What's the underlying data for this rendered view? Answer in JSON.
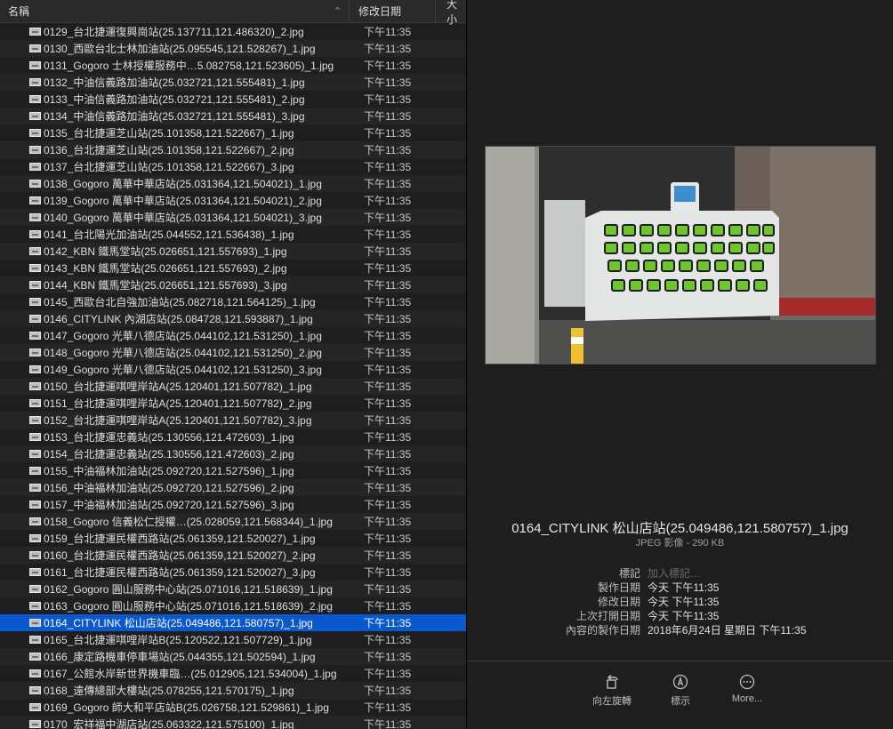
{
  "header": {
    "col_name": "名稱",
    "col_date": "修改日期",
    "col_size": "大小"
  },
  "files": [
    {
      "name": "0129_台北捷運復興崗站(25.137711,121.486320)_2.jpg",
      "date": "下午11:35"
    },
    {
      "name": "0130_西歐台北士林加油站(25.095545,121.528267)_1.jpg",
      "date": "下午11:35"
    },
    {
      "name": "0131_Gogoro 士林授權服務中…5.082758,121.523605)_1.jpg",
      "date": "下午11:35"
    },
    {
      "name": "0132_中油信義路加油站(25.032721,121.555481)_1.jpg",
      "date": "下午11:35"
    },
    {
      "name": "0133_中油信義路加油站(25.032721,121.555481)_2.jpg",
      "date": "下午11:35"
    },
    {
      "name": "0134_中油信義路加油站(25.032721,121.555481)_3.jpg",
      "date": "下午11:35"
    },
    {
      "name": "0135_台北捷運芝山站(25.101358,121.522667)_1.jpg",
      "date": "下午11:35"
    },
    {
      "name": "0136_台北捷運芝山站(25.101358,121.522667)_2.jpg",
      "date": "下午11:35"
    },
    {
      "name": "0137_台北捷運芝山站(25.101358,121.522667)_3.jpg",
      "date": "下午11:35"
    },
    {
      "name": "0138_Gogoro 萬華中華店站(25.031364,121.504021)_1.jpg",
      "date": "下午11:35"
    },
    {
      "name": "0139_Gogoro 萬華中華店站(25.031364,121.504021)_2.jpg",
      "date": "下午11:35"
    },
    {
      "name": "0140_Gogoro 萬華中華店站(25.031364,121.504021)_3.jpg",
      "date": "下午11:35"
    },
    {
      "name": "0141_台北陽光加油站(25.044552,121.536438)_1.jpg",
      "date": "下午11:35"
    },
    {
      "name": "0142_KBN 鐵馬堂站(25.026651,121.557693)_1.jpg",
      "date": "下午11:35"
    },
    {
      "name": "0143_KBN 鐵馬堂站(25.026651,121.557693)_2.jpg",
      "date": "下午11:35"
    },
    {
      "name": "0144_KBN 鐵馬堂站(25.026651,121.557693)_3.jpg",
      "date": "下午11:35"
    },
    {
      "name": "0145_西歐台北自強加油站(25.082718,121.564125)_1.jpg",
      "date": "下午11:35"
    },
    {
      "name": "0146_CITYLINK 內湖店站(25.084728,121.593887)_1.jpg",
      "date": "下午11:35"
    },
    {
      "name": "0147_Gogoro 光華八德店站(25.044102,121.531250)_1.jpg",
      "date": "下午11:35"
    },
    {
      "name": "0148_Gogoro 光華八德店站(25.044102,121.531250)_2.jpg",
      "date": "下午11:35"
    },
    {
      "name": "0149_Gogoro 光華八德店站(25.044102,121.531250)_3.jpg",
      "date": "下午11:35"
    },
    {
      "name": "0150_台北捷運唭哩岸站A(25.120401,121.507782)_1.jpg",
      "date": "下午11:35"
    },
    {
      "name": "0151_台北捷運唭哩岸站A(25.120401,121.507782)_2.jpg",
      "date": "下午11:35"
    },
    {
      "name": "0152_台北捷運唭哩岸站A(25.120401,121.507782)_3.jpg",
      "date": "下午11:35"
    },
    {
      "name": "0153_台北捷運忠義站(25.130556,121.472603)_1.jpg",
      "date": "下午11:35"
    },
    {
      "name": "0154_台北捷運忠義站(25.130556,121.472603)_2.jpg",
      "date": "下午11:35"
    },
    {
      "name": "0155_中油福林加油站(25.092720,121.527596)_1.jpg",
      "date": "下午11:35"
    },
    {
      "name": "0156_中油福林加油站(25.092720,121.527596)_2.jpg",
      "date": "下午11:35"
    },
    {
      "name": "0157_中油福林加油站(25.092720,121.527596)_3.jpg",
      "date": "下午11:35"
    },
    {
      "name": "0158_Gogoro 信義松仁授權…(25.028059,121.568344)_1.jpg",
      "date": "下午11:35"
    },
    {
      "name": "0159_台北捷運民權西路站(25.061359,121.520027)_1.jpg",
      "date": "下午11:35"
    },
    {
      "name": "0160_台北捷運民權西路站(25.061359,121.520027)_2.jpg",
      "date": "下午11:35"
    },
    {
      "name": "0161_台北捷運民權西路站(25.061359,121.520027)_3.jpg",
      "date": "下午11:35"
    },
    {
      "name": "0162_Gogoro 圓山服務中心站(25.071016,121.518639)_1.jpg",
      "date": "下午11:35"
    },
    {
      "name": "0163_Gogoro 圓山服務中心站(25.071016,121.518639)_2.jpg",
      "date": "下午11:35"
    },
    {
      "name": "0164_CITYLINK 松山店站(25.049486,121.580757)_1.jpg",
      "date": "下午11:35"
    },
    {
      "name": "0165_台北捷運唭哩岸站B(25.120522,121.507729)_1.jpg",
      "date": "下午11:35"
    },
    {
      "name": "0166_康定路機車停車場站(25.044355,121.502594)_1.jpg",
      "date": "下午11:35"
    },
    {
      "name": "0167_公館水岸新世界機車臨…(25.012905,121.534004)_1.jpg",
      "date": "下午11:35"
    },
    {
      "name": "0168_遠傳總部大樓站(25.078255,121.570175)_1.jpg",
      "date": "下午11:35"
    },
    {
      "name": "0169_Gogoro 師大和平店站B(25.026758,121.529861)_1.jpg",
      "date": "下午11:35"
    },
    {
      "name": "0170_宏祥福中湖店站(25.063322,121.575100)_1.jpg",
      "date": "下午11:35"
    }
  ],
  "selected_index": 35,
  "selected_color": "#0a58d0",
  "preview": {
    "filename": "0164_CITYLINK 松山店站(25.049486,121.580757)_1.jpg",
    "kind": "JPEG 影像 - 290 KB",
    "meta": [
      {
        "label": "標記",
        "value": "加入標記…",
        "placeholder": true
      },
      {
        "label": "製作日期",
        "value": "今天 下午11:35"
      },
      {
        "label": "修改日期",
        "value": "今天 下午11:35"
      },
      {
        "label": "上次打開日期",
        "value": "今天 下午11:35"
      },
      {
        "label": "內容的製作日期",
        "value": "2018年6月24日 星期日 下午11:35"
      }
    ]
  },
  "actions": [
    {
      "label": "向左旋轉",
      "icon": "rotate-left-icon"
    },
    {
      "label": "標示",
      "icon": "markup-icon"
    },
    {
      "label": "More...",
      "icon": "more-icon"
    }
  ]
}
